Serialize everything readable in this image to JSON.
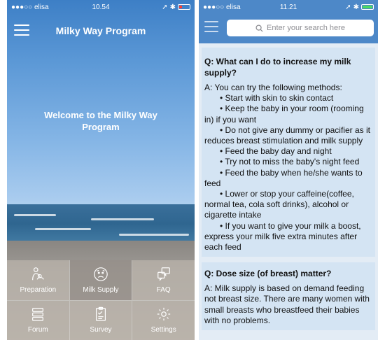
{
  "left": {
    "status": {
      "carrier": "●●●○○ elisa",
      "time": "10.54",
      "battery_color": "#ff3b30"
    },
    "nav_title": "Milky Way Program",
    "welcome": "Welcome to the Milky Way Program",
    "tiles": [
      {
        "label": "Preparation",
        "icon": "mother-baby-icon"
      },
      {
        "label": "Milk Supply",
        "icon": "worried-face-icon"
      },
      {
        "label": "FAQ",
        "icon": "chat-bubbles-icon"
      },
      {
        "label": "Forum",
        "icon": "forum-stack-icon"
      },
      {
        "label": "Survey",
        "icon": "clipboard-icon"
      },
      {
        "label": "Settings",
        "icon": "gear-icon"
      }
    ]
  },
  "right": {
    "status": {
      "carrier": "●●●○○ elisa",
      "time": "11.21",
      "battery_color": "#4cd964"
    },
    "search_placeholder": "Enter your search here",
    "faq": [
      {
        "question": "Q: What can I do to increase my milk supply?",
        "answer_intro": "A: You can try the following methods:",
        "methods": [
          "• Start with skin to skin contact",
          "• Keep the baby in your room (rooming in) if you want",
          "• Do not give any dummy or pacifier as it reduces breast stimulation and milk supply",
          "• Feed the baby day and night",
          "• Try not to miss the baby's night feed",
          "• Feed the baby when he/she wants to feed",
          "• Lower or stop your caffeine(coffee, normal tea, cola soft drinks), alcohol or cigarette intake",
          "• If you want to give your milk a boost, express your milk five extra minutes after each feed"
        ]
      },
      {
        "question": "Q: Dose size (of breast) matter?",
        "answer": "A: Milk supply is based on demand feeding not breast size. There are many women with small breasts who breastfeed their babies with no problems."
      }
    ]
  }
}
